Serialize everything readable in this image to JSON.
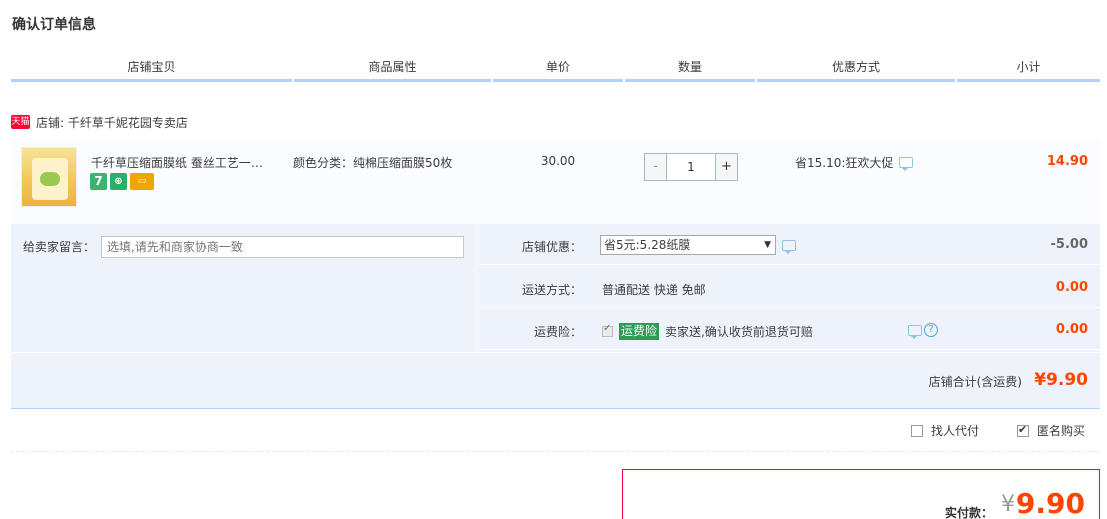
{
  "page": {
    "title": "确认订单信息"
  },
  "table_headers": [
    "店铺宝贝",
    "商品属性",
    "单价",
    "数量",
    "优惠方式",
    "小计"
  ],
  "shop": {
    "badge": "天猫",
    "label": "店铺: 千纤草千妮花园专卖店"
  },
  "item": {
    "title": "千纤草压缩面膜纸 蚕丝工艺一…",
    "icons": [
      "7",
      "⊕",
      "▭"
    ],
    "attribute": "颜色分类：纯棉压缩面膜50枚",
    "price": "30.00",
    "quantity": "1",
    "qty_minus": "-",
    "qty_plus": "+",
    "promotion": "省15.10:狂欢大促",
    "subtotal": "14.90"
  },
  "message": {
    "label": "给卖家留言：",
    "placeholder": "选填,请先和商家协商一致"
  },
  "shop_discount": {
    "label": "店铺优惠：",
    "selected": "省5元:5.28纸膜",
    "amount": "-5.00"
  },
  "shipping": {
    "label": "运送方式：",
    "value": "普通配送 快递 免邮",
    "amount": "0.00"
  },
  "insurance": {
    "label": "运费险：",
    "badge": "运费险",
    "text": "卖家送,确认收货前退货可赔",
    "amount": "0.00",
    "help": "?"
  },
  "shop_total": {
    "label": "店铺合计(含运费)",
    "amount": "¥9.90"
  },
  "options": {
    "proxy_pay": "找人代付",
    "anonymous": "匿名购买"
  },
  "payment": {
    "label": "实付款：",
    "symbol": "¥",
    "amount": "9.90"
  },
  "colors": {
    "accent_red": "#ff4400",
    "header_rule": "#b2d1ff",
    "panel_bg": "#eef3fb",
    "tmall_red": "#ff0036"
  }
}
